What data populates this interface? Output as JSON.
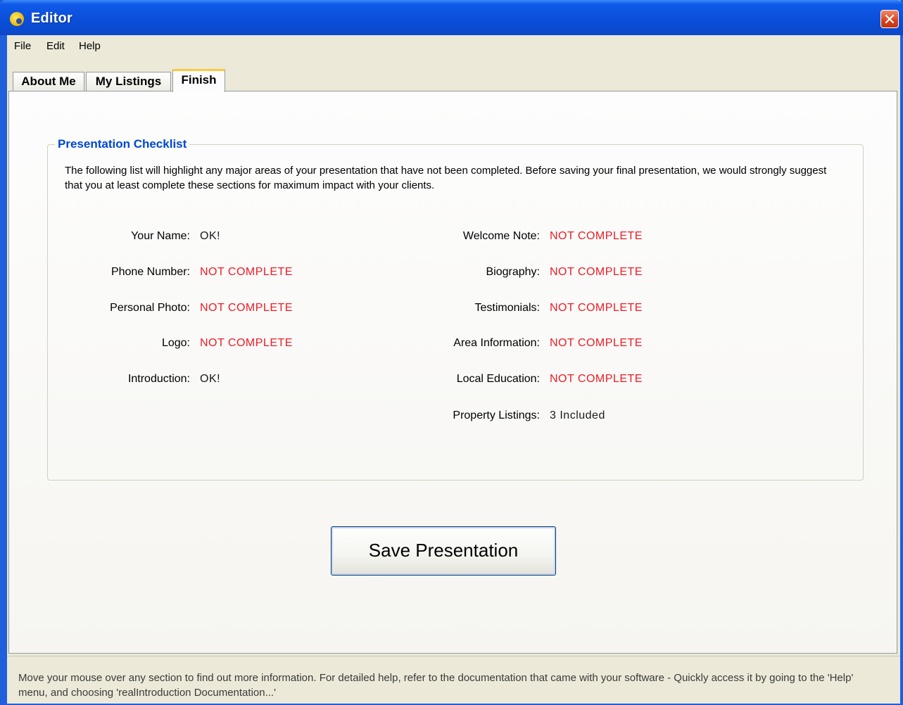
{
  "window": {
    "title": "Editor",
    "close_glyph": "✕"
  },
  "menu": {
    "items": [
      "File",
      "Edit",
      "Help"
    ]
  },
  "tabs": [
    {
      "label": "About Me",
      "active": false
    },
    {
      "label": "My Listings",
      "active": false
    },
    {
      "label": "Finish",
      "active": true
    }
  ],
  "checklist": {
    "title": "Presentation Checklist",
    "intro": "The following list will highlight any major areas of your presentation that have not been completed. Before saving your final presentation, we would strongly suggest that you at least complete these sections for maximum impact with your clients.",
    "left": [
      {
        "label": "Your Name:",
        "value": "OK!",
        "status": "ok"
      },
      {
        "label": "Phone Number:",
        "value": "NOT COMPLETE",
        "status": "incomplete"
      },
      {
        "label": "Personal Photo:",
        "value": "NOT COMPLETE",
        "status": "incomplete"
      },
      {
        "label": "Logo:",
        "value": "NOT COMPLETE",
        "status": "incomplete"
      },
      {
        "label": "Introduction:",
        "value": "OK!",
        "status": "ok"
      }
    ],
    "right": [
      {
        "label": "Welcome Note:",
        "value": "NOT COMPLETE",
        "status": "incomplete"
      },
      {
        "label": "Biography:",
        "value": "NOT COMPLETE",
        "status": "incomplete"
      },
      {
        "label": "Testimonials:",
        "value": "NOT COMPLETE",
        "status": "incomplete"
      },
      {
        "label": "Area Information:",
        "value": "NOT COMPLETE",
        "status": "incomplete"
      },
      {
        "label": "Local Education:",
        "value": "NOT COMPLETE",
        "status": "incomplete"
      },
      {
        "label": "Property Listings:",
        "value": "3 Included",
        "status": "info"
      }
    ]
  },
  "save_button": {
    "label": "Save Presentation"
  },
  "status": {
    "text": "Move your mouse over any section to find out more information. For detailed help, refer to the documentation that came with your software - Quickly access it by going to the 'Help' menu, and choosing 'realIntroduction Documentation...'"
  },
  "colors": {
    "incomplete": "#ee1c24",
    "ok": "#1a1a1a",
    "info": "#1a1a1a",
    "group_title": "#0046d5",
    "titlebar": "#0a4ed8"
  }
}
